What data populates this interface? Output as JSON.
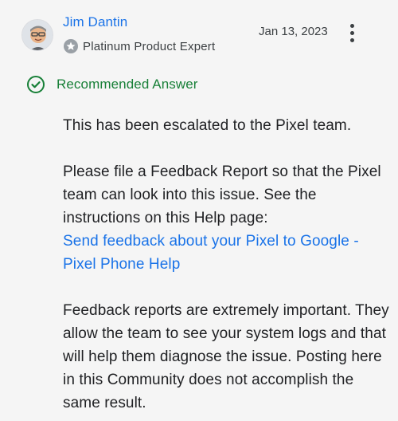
{
  "post": {
    "author_name": "Jim Dantin",
    "author_badge": "Platinum Product Expert",
    "badge_icon": "star-badge-icon",
    "date": "Jan 13, 2023",
    "more_icon": "more-vert-icon",
    "recommended_icon": "check-circle-icon",
    "recommended_label": "Recommended Answer",
    "paragraph1": "This has been escalated to the Pixel team.",
    "paragraph2_text": "Please file a Feedback Report so that the Pixel team can look into this issue. See the instructions on this Help page:",
    "paragraph2_link": "Send feedback about your Pixel to Google - Pixel Phone Help",
    "paragraph3": "Feedback reports are extremely important. They allow the team to see your system logs and that will help them diagnose the issue. Posting here in this Community does not accomplish the same result."
  },
  "colors": {
    "link": "#1a73e8",
    "recommended": "#188038",
    "text": "#202124",
    "background": "#f5f5f5"
  }
}
